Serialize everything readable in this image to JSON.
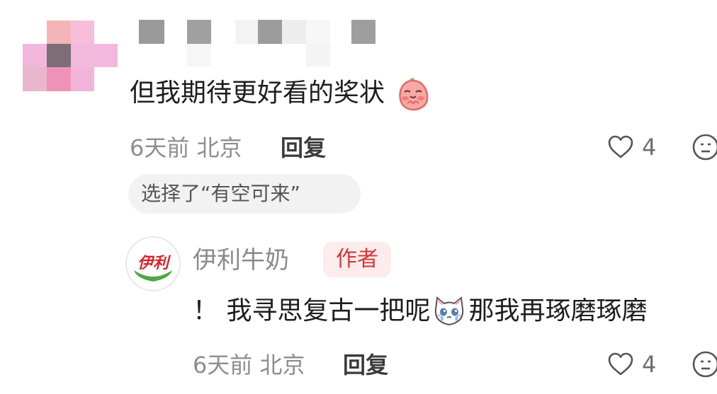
{
  "comment": {
    "text": "但我期待更好看的奖状",
    "emoji": "peach-pleading-emoji",
    "meta": "6天前 北京",
    "reply_label": "回复",
    "like_count": "4",
    "choice_chip": "选择了“有空可来”"
  },
  "author_reply": {
    "author_name": "伊利牛奶",
    "author_badge": "作者",
    "avatar_logo_text": "伊利",
    "text_before": "！ 我寻思复古一把呢",
    "text_after": "那我再琢磨琢磨",
    "emoji": "crying-cat-emoji",
    "meta": "6天前 北京",
    "reply_label": "回复",
    "like_count": "4"
  },
  "colors": {
    "badge_bg": "#fdecec",
    "badge_text": "#d5363b",
    "meta_gray": "#8e8e8e",
    "logo_red": "#d7262c",
    "logo_green": "#4fa746"
  }
}
